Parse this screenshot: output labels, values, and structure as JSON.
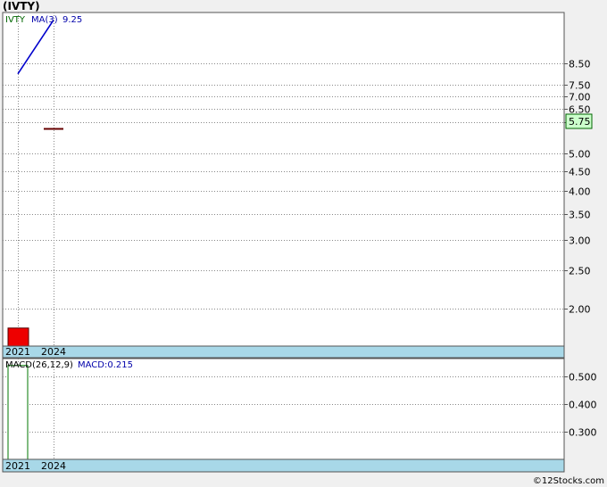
{
  "title": "(IVTY)",
  "watermark": "©12Stocks.com",
  "colors": {
    "price_bar": "#ee0000",
    "ma_line": "#0000cc",
    "candle": "#660000",
    "last_price_bg": "#ccffcc",
    "axis_band": "#a8d8e8",
    "macd_bar_fill": "#ffffff",
    "macd_bar_stroke": "#007700",
    "legend_ticker": "#006600",
    "legend_ma": "#0000aa"
  },
  "chart_data": [
    {
      "type": "line",
      "panel": "price",
      "legend": {
        "ticker": "IVTY",
        "ma_label": "MA(3)",
        "ma_value": "9.25"
      },
      "last_price": "5.75",
      "y_scale": "log",
      "ylim": [
        1.6,
        11.5
      ],
      "y_ticks": [
        "8.50",
        "7.50",
        "7.00",
        "6.50",
        "6.00",
        "5.00",
        "4.50",
        "4.00",
        "3.50",
        "3.00",
        "2.50",
        "2.00"
      ],
      "x_labels": [
        "2021",
        "2024"
      ],
      "ma_series": [
        {
          "x": "2021",
          "y": 8.0
        },
        {
          "x": "2024",
          "y": 11.0
        }
      ],
      "price_bars": [
        {
          "x": "2021",
          "low": 1.6,
          "high": 1.78
        }
      ],
      "candles": [
        {
          "x": "2024",
          "open": 5.78,
          "close": 5.78
        }
      ],
      "grid": true
    },
    {
      "type": "bar",
      "panel": "macd",
      "legend": {
        "name": "MACD(26,12,9)",
        "value_label": "MACD:0.215"
      },
      "ylim": [
        0.2,
        0.565
      ],
      "y_ticks": [
        "0.500",
        "0.400",
        "0.300"
      ],
      "x_labels": [
        "2021",
        "2024"
      ],
      "bars": [
        {
          "x": "2021",
          "value": 0.54
        }
      ],
      "grid": true
    }
  ]
}
